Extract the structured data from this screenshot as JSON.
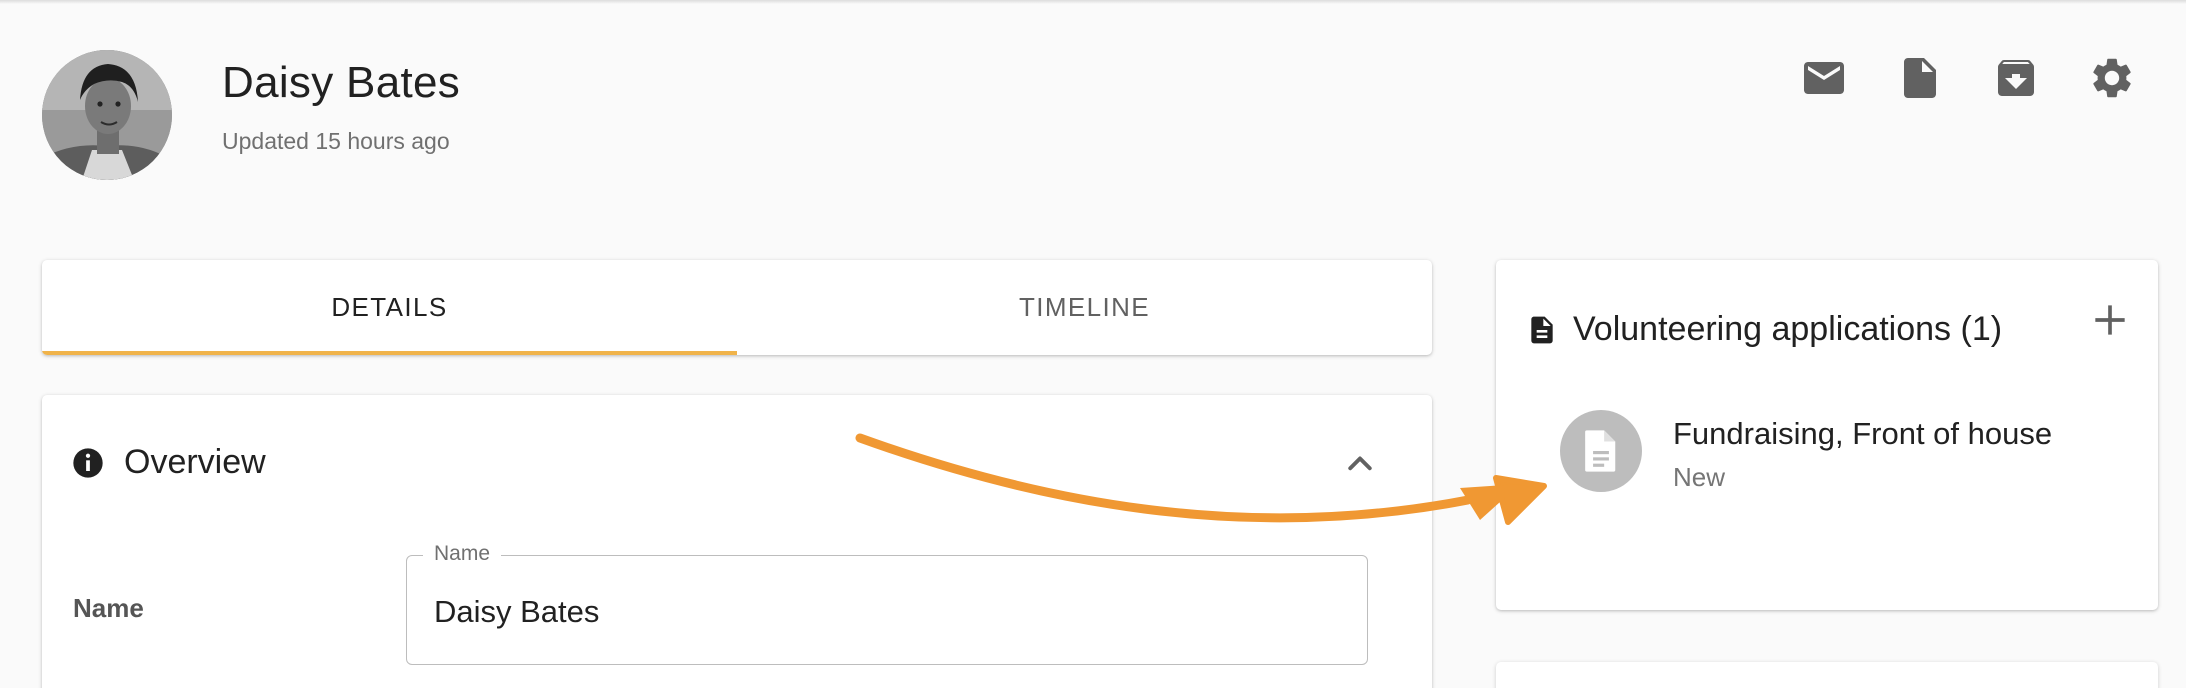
{
  "profile": {
    "name": "Daisy Bates",
    "updated": "Updated 15 hours ago"
  },
  "header_actions": [
    {
      "icon": "mail-icon"
    },
    {
      "icon": "document-icon"
    },
    {
      "icon": "archive-icon"
    },
    {
      "icon": "gear-icon"
    }
  ],
  "tabs": [
    {
      "label": "DETAILS",
      "active": true
    },
    {
      "label": "TIMELINE",
      "active": false
    }
  ],
  "overview": {
    "title": "Overview",
    "fields": {
      "name": {
        "label": "Name",
        "legend": "Name",
        "value": "Daisy Bates"
      }
    }
  },
  "applications": {
    "title": "Volunteering applications (1)",
    "items": [
      {
        "title": "Fundraising, Front of house",
        "status": "New"
      }
    ]
  },
  "colors": {
    "accent": "#f0b34a",
    "arrow": "#f09833",
    "background": "#fafafa"
  }
}
